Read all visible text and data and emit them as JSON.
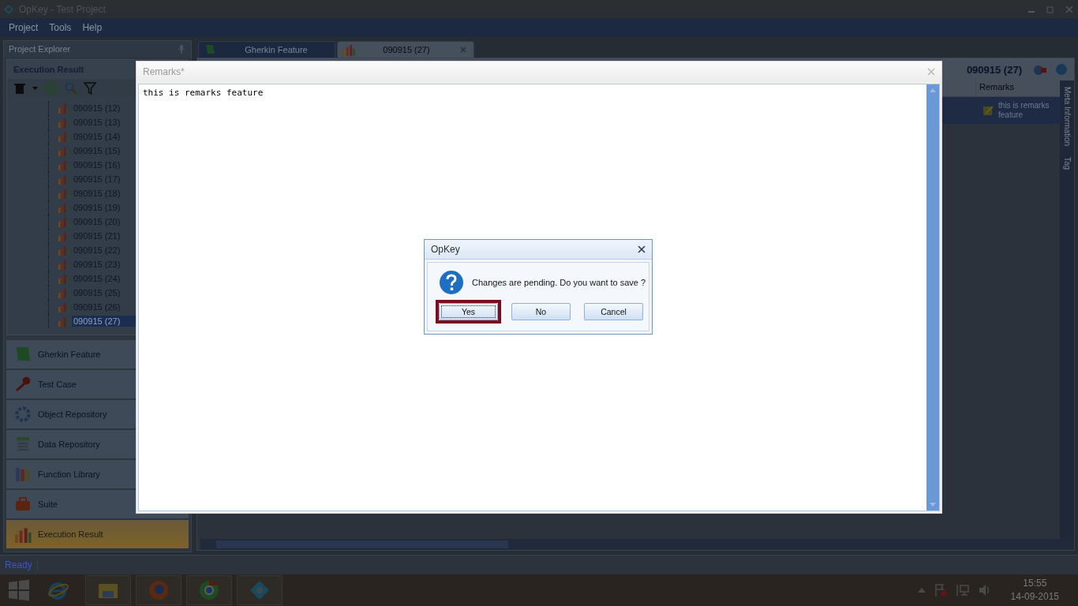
{
  "app": {
    "title": "OpKey - Test Project",
    "menu": [
      "Project",
      "Tools",
      "Help"
    ]
  },
  "explorer": {
    "title": "Project Explorer",
    "section": "Execution Result",
    "tree": [
      {
        "label": "090915 (12)",
        "selected": false
      },
      {
        "label": "090915 (13)",
        "selected": false
      },
      {
        "label": "090915 (14)",
        "selected": false
      },
      {
        "label": "090915 (15)",
        "selected": false
      },
      {
        "label": "090915 (16)",
        "selected": false
      },
      {
        "label": "090915 (17)",
        "selected": false
      },
      {
        "label": "090915 (18)",
        "selected": false
      },
      {
        "label": "090915 (19)",
        "selected": false
      },
      {
        "label": "090915 (20)",
        "selected": false
      },
      {
        "label": "090915 (21)",
        "selected": false
      },
      {
        "label": "090915 (22)",
        "selected": false
      },
      {
        "label": "090915 (23)",
        "selected": false
      },
      {
        "label": "090915 (24)",
        "selected": false
      },
      {
        "label": "090915 (25)",
        "selected": false
      },
      {
        "label": "090915 (26)",
        "selected": false
      },
      {
        "label": "090915 (27)",
        "selected": true
      }
    ],
    "nav": [
      {
        "label": "Gherkin Feature",
        "kind": "scroll",
        "selected": false
      },
      {
        "label": "Test Case",
        "kind": "key",
        "selected": false
      },
      {
        "label": "Object Repository",
        "kind": "gear",
        "selected": false
      },
      {
        "label": "Data Repository",
        "kind": "sheet",
        "selected": false
      },
      {
        "label": "Function Library",
        "kind": "books",
        "selected": false
      },
      {
        "label": "Suite",
        "kind": "case",
        "selected": false
      },
      {
        "label": "Execution Result",
        "kind": "chart",
        "selected": true
      }
    ]
  },
  "tabs": [
    {
      "label": "Gherkin Feature",
      "kind": "scroll",
      "selected": false,
      "closable": false
    },
    {
      "label": "090915 (27)",
      "kind": "chart",
      "selected": true,
      "closable": true
    }
  ],
  "content": {
    "title": "090915 (27)",
    "columns": [
      "Remarks"
    ],
    "rows": [
      {
        "remarks": "this is remarks feature"
      }
    ],
    "side_tabs": [
      "Meta Information",
      "Tag"
    ]
  },
  "remarks_window": {
    "title": "Remarks*",
    "text": "this is remarks feature"
  },
  "dialog": {
    "title": "OpKey",
    "message": "Changes are pending. Do you want to save ?",
    "buttons": [
      {
        "label": "Yes",
        "focused": true
      },
      {
        "label": "No",
        "focused": false
      },
      {
        "label": "Cancel",
        "focused": false
      }
    ]
  },
  "status_bar": "Ready",
  "taskbar": {
    "time": "15:55",
    "date": "14-09-2015"
  }
}
